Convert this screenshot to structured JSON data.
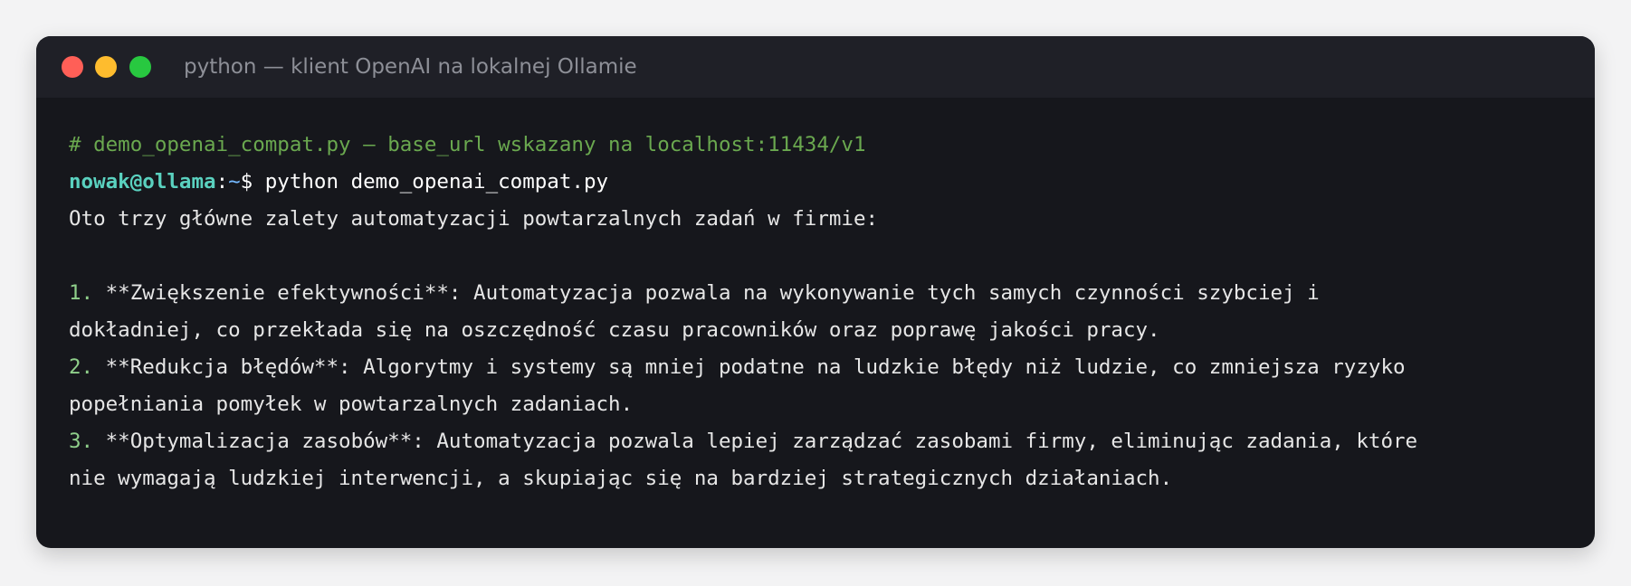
{
  "window": {
    "title": "python — klient OpenAI na lokalnej Ollamie"
  },
  "terminal": {
    "comment": "# demo_openai_compat.py — base_url wskazany na localhost:11434/v1",
    "prompt": {
      "user_host": "nowak@ollama",
      "separator": ":",
      "path": "~",
      "symbol": "$ ",
      "command": "python demo_openai_compat.py"
    },
    "output": {
      "intro": "Oto trzy główne zalety automatyzacji powtarzalnych zadań w firmie:",
      "items": [
        {
          "number": "1.",
          "line1": " **Zwiększenie efektywności**: Automatyzacja pozwala na wykonywanie tych samych czynności szybciej i",
          "line2": "dokładniej, co przekłada się na oszczędność czasu pracowników oraz poprawę jakości pracy."
        },
        {
          "number": "2.",
          "line1": " **Redukcja błędów**: Algorytmy i systemy są mniej podatne na ludzkie błędy niż ludzie, co zmniejsza ryzyko",
          "line2": "popełniania pomyłek w powtarzalnych zadaniach."
        },
        {
          "number": "3.",
          "line1": " **Optymalizacja zasobów**: Automatyzacja pozwala lepiej zarządzać zasobami firmy, eliminując zadania, które",
          "line2": "nie wymagają ludzkiej interwencji, a skupiając się na bardziej strategicznych działaniach."
        }
      ]
    }
  }
}
